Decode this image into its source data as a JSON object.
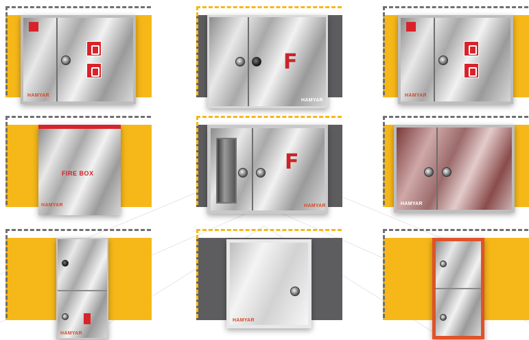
{
  "brand": "HAMYAR",
  "tiles": [
    {
      "panel": "yellow",
      "cabinet_label": ""
    },
    {
      "panel": "gray",
      "cabinet_label": "F"
    },
    {
      "panel": "yellow",
      "cabinet_label": ""
    },
    {
      "panel": "yellow",
      "cabinet_label": "FIRE BOX"
    },
    {
      "panel": "gray",
      "cabinet_label": "F"
    },
    {
      "panel": "yellow",
      "cabinet_label": ""
    },
    {
      "panel": "yellow",
      "cabinet_label": ""
    },
    {
      "panel": "gray",
      "cabinet_label": ""
    },
    {
      "panel": "yellow",
      "cabinet_label": ""
    }
  ],
  "colors": {
    "yellow": "#f6b719",
    "gray": "#5d5d5f",
    "dash": "#707072",
    "red": "#d41f26"
  }
}
